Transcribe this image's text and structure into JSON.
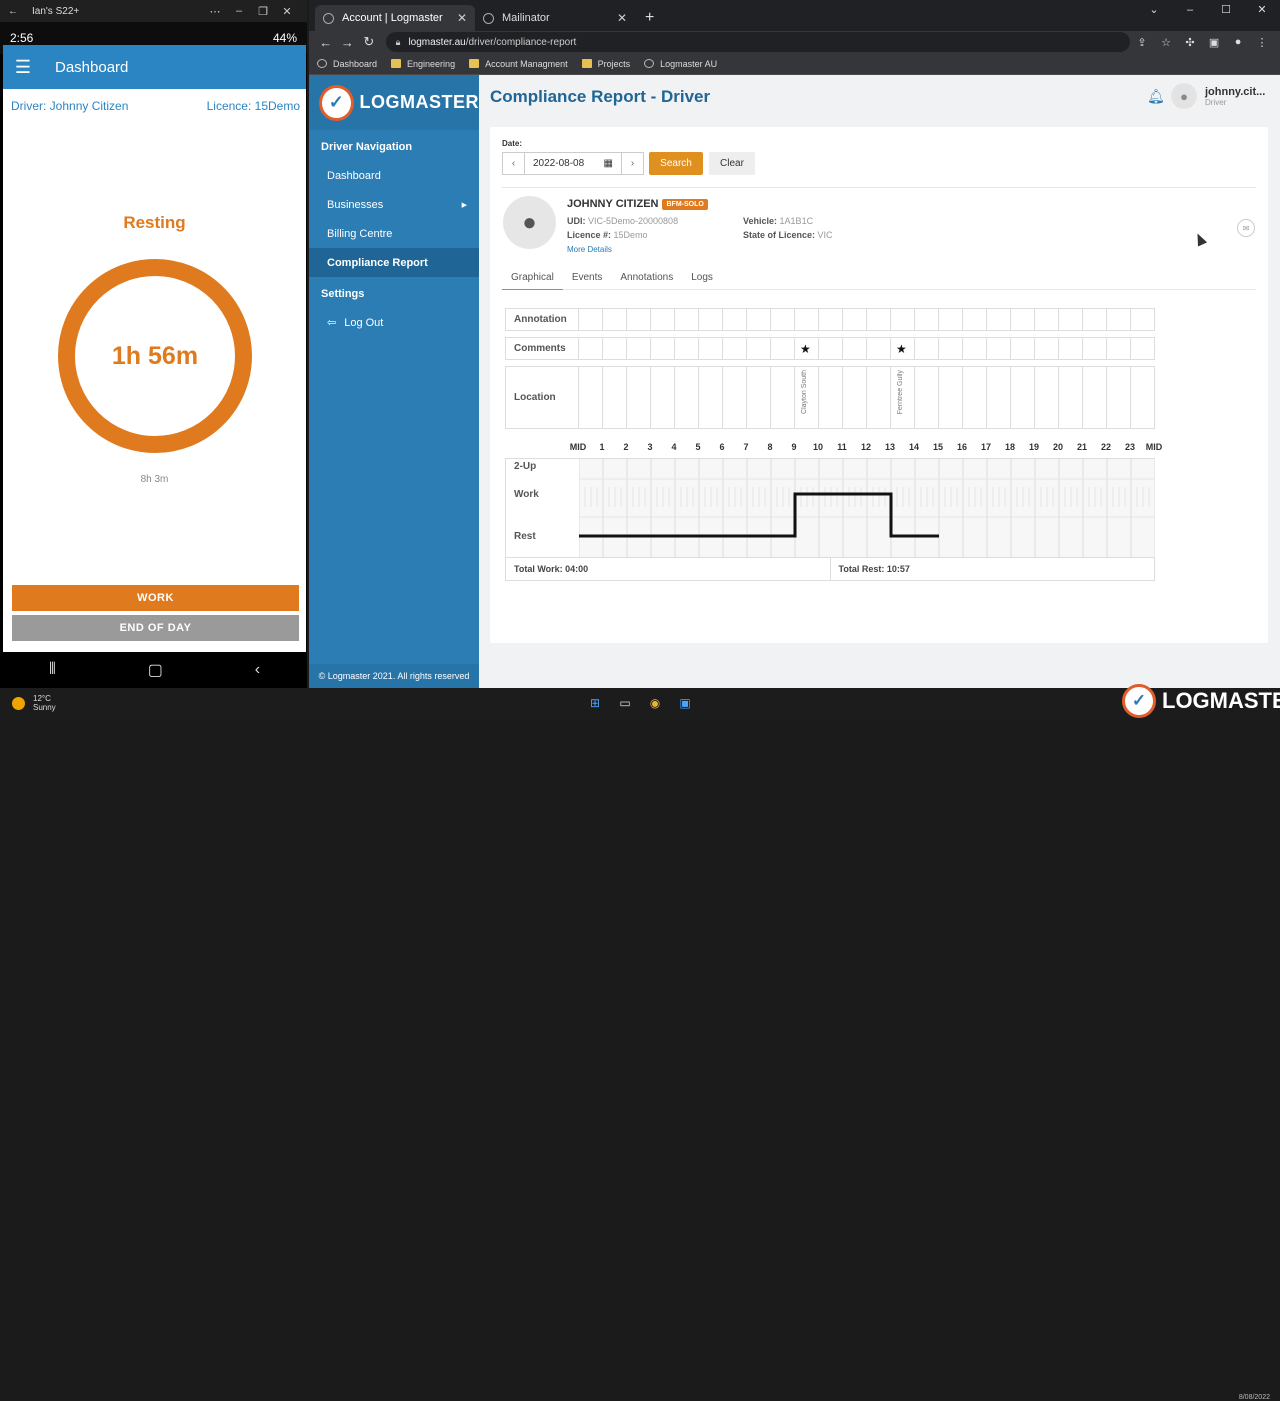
{
  "phone": {
    "window_title": "Ian's S22+",
    "time": "2:56",
    "battery": "44%",
    "app_title": "Dashboard",
    "driver": "Driver: Johnny Citizen",
    "licence": "Licence: 15Demo",
    "status": "Resting",
    "timer": "1h 56m",
    "sub_timer": "8h 3m",
    "work_button": "WORK",
    "end_day_button": "END OF DAY",
    "accent": "#e07a1f",
    "primary": "#2b85c3"
  },
  "browser": {
    "tabs": [
      {
        "label": "Account | Logmaster"
      },
      {
        "label": "Mailinator"
      }
    ],
    "url_host": "logmaster.au",
    "url_path": "/driver/compliance-report",
    "bookmarks": [
      {
        "label": "Dashboard"
      },
      {
        "label": "Engineering"
      },
      {
        "label": "Account Managment"
      },
      {
        "label": "Projects"
      },
      {
        "label": "Logmaster AU"
      }
    ]
  },
  "app": {
    "logo_text": "LOGMASTER",
    "nav_heading": "Driver Navigation",
    "nav_items": [
      {
        "label": "Dashboard"
      },
      {
        "label": "Businesses"
      },
      {
        "label": "Billing Centre"
      },
      {
        "label": "Compliance Report"
      }
    ],
    "settings_label": "Settings",
    "logout_label": "Log Out",
    "footer": "© Logmaster 2021. All rights reserved",
    "page_title": "Compliance Report - Driver",
    "user_name": "johnny.cit...",
    "user_role": "Driver",
    "date_label": "Date:",
    "date_value": "2022-08-08",
    "search_label": "Search",
    "clear_label": "Clear",
    "driver_name": "JOHNNY CITIZEN",
    "driver_tag": "BFM-SOLO",
    "udi_label": "UDI:",
    "udi_value": "VIC-5Demo-20000808",
    "licence_label": "Licence #:",
    "licence_value": "15Demo",
    "vehicle_label": "Vehicle:",
    "vehicle_value": "1A1B1C",
    "state_label": "State of Licence:",
    "state_value": "VIC",
    "more_details": "More Details",
    "report_tabs": [
      {
        "label": "Graphical"
      },
      {
        "label": "Events"
      },
      {
        "label": "Annotations"
      },
      {
        "label": "Logs"
      }
    ],
    "row_labels": {
      "annotation": "Annotation",
      "comments": "Comments",
      "location": "Location",
      "two_up": "2-Up",
      "work": "Work",
      "rest": "Rest"
    },
    "locations": [
      "Clayton South",
      "Ferntree Gully"
    ],
    "hour_labels": [
      "MID",
      "1",
      "2",
      "3",
      "4",
      "5",
      "6",
      "7",
      "8",
      "9",
      "10",
      "11",
      "12",
      "13",
      "14",
      "15",
      "16",
      "17",
      "18",
      "19",
      "20",
      "21",
      "22",
      "23",
      "MID"
    ],
    "total_work": "Total Work:  04:00",
    "total_rest": "Total Rest:  10:57"
  },
  "chart_data": {
    "type": "line",
    "title": "",
    "xlabel": "",
    "ylabel": "",
    "xlim": [
      0,
      24
    ],
    "y_categories": [
      "Rest",
      "Work",
      "2-Up"
    ],
    "series": [
      {
        "x": [
          0,
          9,
          9,
          13,
          13,
          15
        ],
        "y": [
          "Rest",
          "Rest",
          "Work",
          "Work",
          "Rest",
          "Rest"
        ]
      }
    ],
    "comment_markers_hours": [
      9,
      13
    ],
    "location_marks": [
      {
        "hour": 9,
        "label": "Clayton South"
      },
      {
        "hour": 13,
        "label": "Ferntree Gully"
      }
    ]
  },
  "taskbar": {
    "temp": "12°C",
    "condition": "Sunny",
    "date": "8/08/2022"
  }
}
